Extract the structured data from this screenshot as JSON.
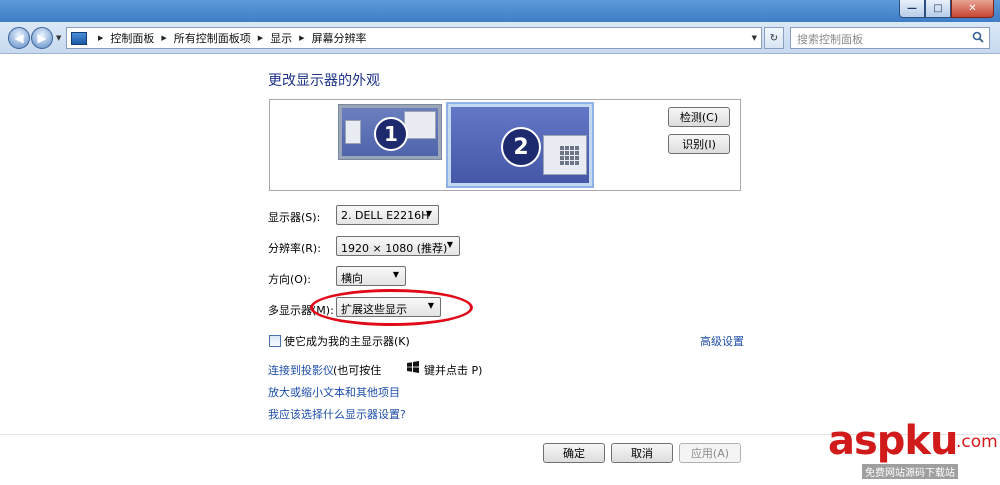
{
  "window": {
    "controls": {
      "minimize": "—",
      "maximize": "□",
      "close": "✕"
    }
  },
  "navigation": {
    "breadcrumb": [
      "控制面板",
      "所有控制面板项",
      "显示",
      "屏幕分辨率"
    ],
    "search_placeholder": "搜索控制面板"
  },
  "content": {
    "heading": "更改显示器的外观",
    "monitors": [
      {
        "number": "1"
      },
      {
        "number": "2"
      }
    ],
    "detect_button": "检测(C)",
    "identify_button": "识别(I)",
    "display_label": "显示器(S):",
    "display_value": "2. DELL E2216H",
    "resolution_label": "分辨率(R):",
    "resolution_value": "1920 × 1080 (推荐)",
    "orientation_label": "方向(O):",
    "orientation_value": "横向",
    "multi_display_label": "多显示器(M):",
    "multi_display_value": "扩展这些显示",
    "primary_checkbox_label": "使它成为我的主显示器(K)",
    "advanced_link": "高级设置",
    "projector_link": "连接到投影仪",
    "projector_hint_prefix": "(也可按住",
    "projector_hint_suffix": "键并点击 P)",
    "text_size_link": "放大或缩小文本和其他项目",
    "help_link": "我应该选择什么显示器设置?"
  },
  "footer": {
    "ok": "确定",
    "cancel": "取消",
    "apply": "应用(A)"
  },
  "watermark": {
    "brand": "aspku",
    "domain": ".com",
    "tagline": "免费网站源码下载站"
  },
  "colors": {
    "heading": "#1e3287",
    "link": "#1e4ea8",
    "highlight_ellipse": "#e10a18",
    "watermark": "#d11a1a"
  }
}
